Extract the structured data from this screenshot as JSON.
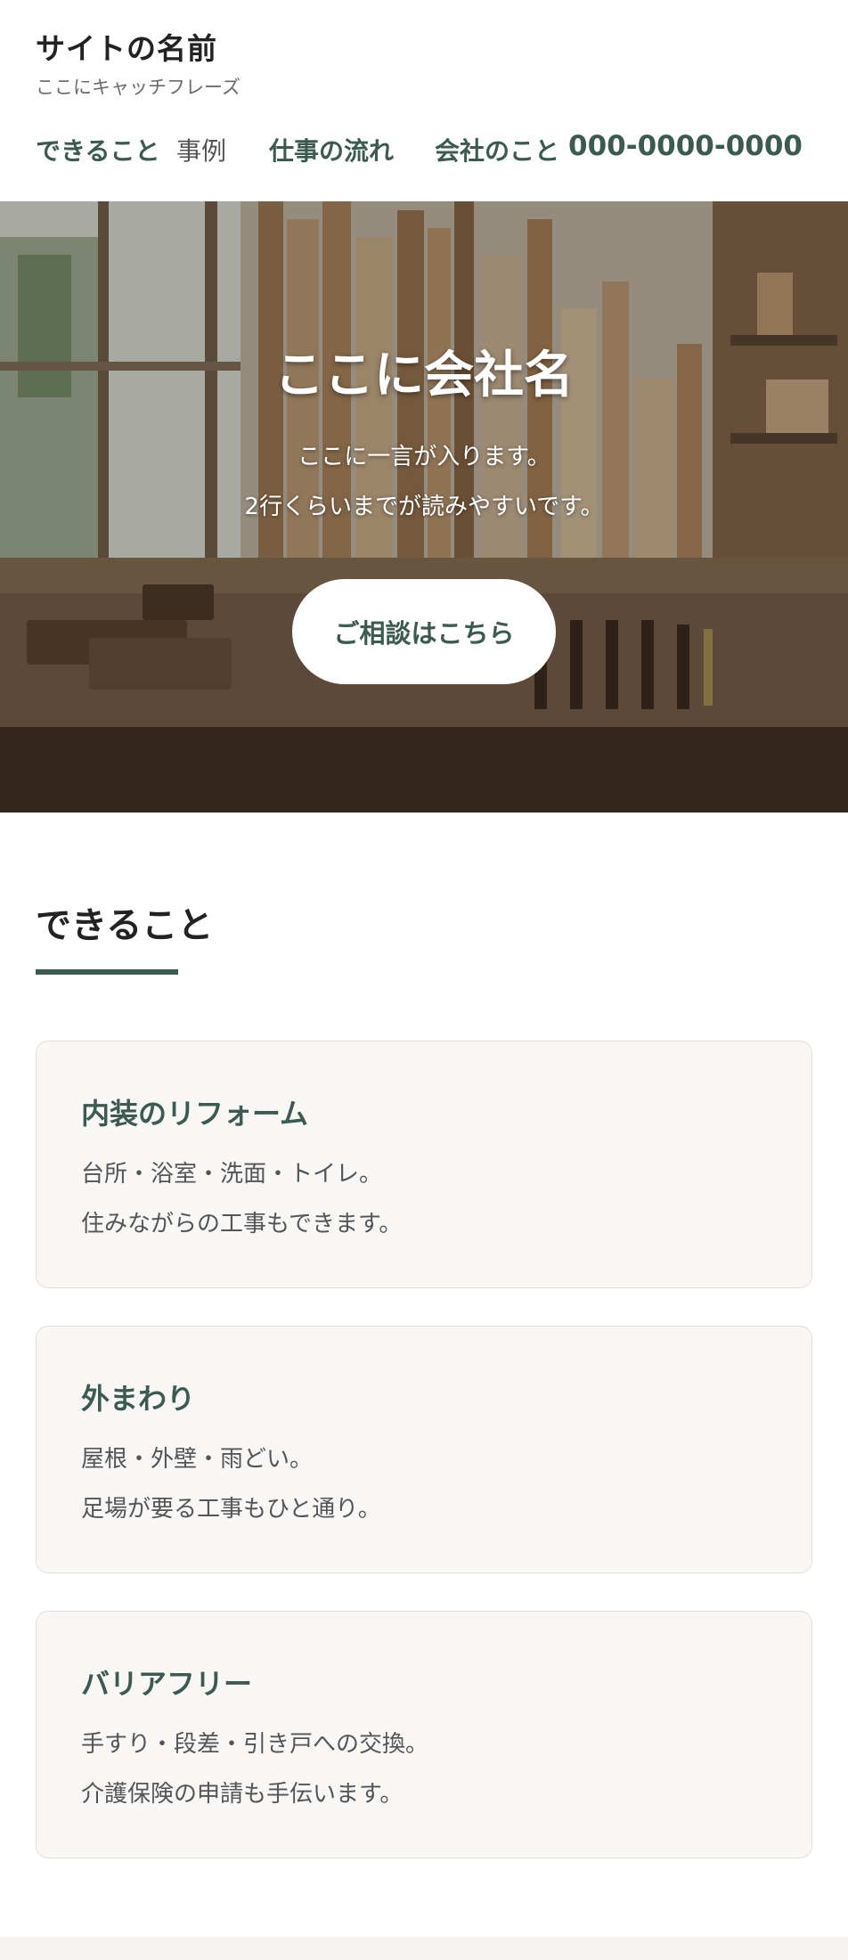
{
  "header": {
    "site_title": "サイトの名前",
    "catchphrase": "ここにキャッチフレーズ",
    "nav": [
      {
        "label": "できること"
      },
      {
        "label": "事例"
      },
      {
        "label": "仕事の流れ"
      },
      {
        "label": "会社のこと"
      }
    ],
    "phone": "000-0000-0000"
  },
  "hero": {
    "title": "ここに会社名",
    "lines": [
      "ここに一言が入ります。",
      "2行くらいまでが読みやすいです。"
    ],
    "cta_label": "ご相談はこちら",
    "image_description_icon": "workshop-image"
  },
  "services": {
    "heading": "できること",
    "cards": [
      {
        "title": "内装のリフォーム",
        "lines": [
          "台所・浴室・洗面・トイレ。",
          "住みながらの工事もできます。"
        ]
      },
      {
        "title": "外まわり",
        "lines": [
          "屋根・外壁・雨どい。",
          "足場が要る工事もひと通り。"
        ]
      },
      {
        "title": "バリアフリー",
        "lines": [
          "手すり・段差・引き戸への交換。",
          "介護保険の申請も手伝います。"
        ]
      }
    ]
  },
  "colors": {
    "accent": "#3d5a50",
    "card_bg": "#f8f7f5",
    "card_border": "#e2dfdb"
  }
}
